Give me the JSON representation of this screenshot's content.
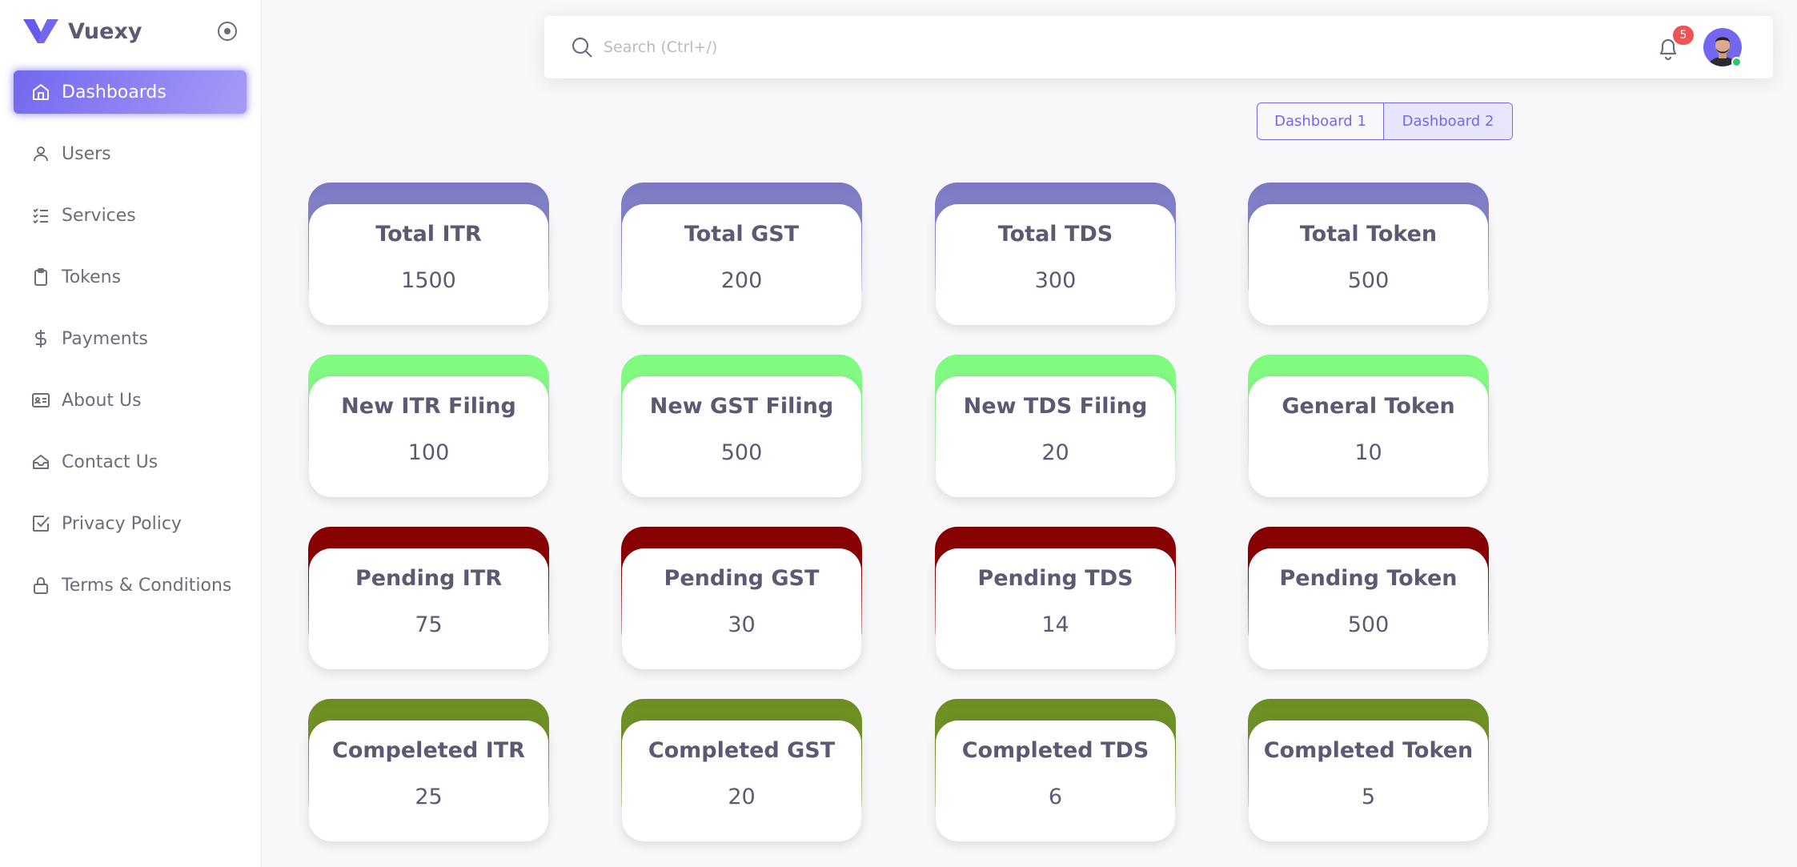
{
  "brand": {
    "name": "Vuexy"
  },
  "sidebar": {
    "items": [
      {
        "label": "Dashboards",
        "icon": "home-icon",
        "active": true
      },
      {
        "label": "Users",
        "icon": "user-icon",
        "active": false
      },
      {
        "label": "Services",
        "icon": "list-check-icon",
        "active": false
      },
      {
        "label": "Tokens",
        "icon": "clipboard-icon",
        "active": false
      },
      {
        "label": "Payments",
        "icon": "dollar-icon",
        "active": false
      },
      {
        "label": "About Us",
        "icon": "id-card-icon",
        "active": false
      },
      {
        "label": "Contact Us",
        "icon": "inbox-icon",
        "active": false
      },
      {
        "label": "Privacy Policy",
        "icon": "check-square-icon",
        "active": false
      },
      {
        "label": "Terms & Conditions",
        "icon": "lock-icon",
        "active": false
      }
    ]
  },
  "topbar": {
    "search_placeholder": "Search (Ctrl+/)",
    "notifications_count": "5"
  },
  "toggle": {
    "dashboard1": "Dashboard 1",
    "dashboard2": "Dashboard 2",
    "selected": "Dashboard 2"
  },
  "colors": {
    "primary": "#7367f0",
    "row_total": "#7a78c2",
    "row_new": "#7cfc7c",
    "row_pending": "#850000",
    "row_completed": "#6b8e23",
    "badge": "#ea5455",
    "online": "#28c76f"
  },
  "cards": [
    [
      {
        "title": "Total ITR",
        "value": "1500"
      },
      {
        "title": "Total GST",
        "value": "200"
      },
      {
        "title": "Total TDS",
        "value": "300"
      },
      {
        "title": "Total Token",
        "value": "500"
      }
    ],
    [
      {
        "title": "New ITR Filing",
        "value": "100"
      },
      {
        "title": "New GST Filing",
        "value": "500"
      },
      {
        "title": "New TDS Filing",
        "value": "20"
      },
      {
        "title": "General Token",
        "value": "10"
      }
    ],
    [
      {
        "title": "Pending ITR",
        "value": "75"
      },
      {
        "title": "Pending GST",
        "value": "30"
      },
      {
        "title": "Pending TDS",
        "value": "14"
      },
      {
        "title": "Pending Token",
        "value": "500"
      }
    ],
    [
      {
        "title": "Compeleted ITR",
        "value": "25"
      },
      {
        "title": "Completed GST",
        "value": "20"
      },
      {
        "title": "Completed TDS",
        "value": "6"
      },
      {
        "title": "Completed Token",
        "value": "5"
      }
    ]
  ]
}
